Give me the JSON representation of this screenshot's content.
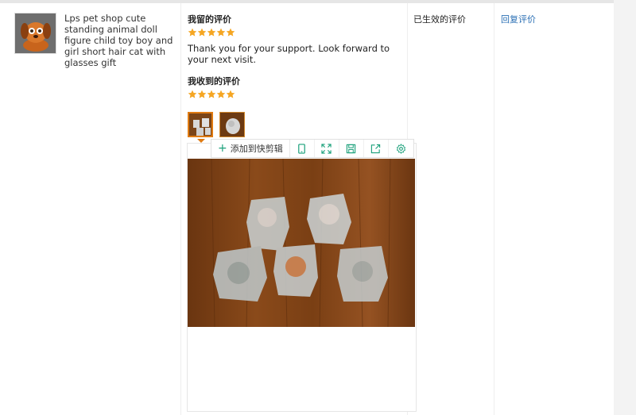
{
  "product": {
    "title": "Lps pet shop cute standing animal doll figure child toy boy and girl short hair cat with glasses gift",
    "thumbnail_icon": "product-photo"
  },
  "review": {
    "my_review_label": "我留的评价",
    "my_rating": 5,
    "my_text": "Thank you for your support. Look forward to your next visit.",
    "received_review_label": "我收到的评价",
    "received_rating": 5,
    "star_color": "#f5a623"
  },
  "attachments": {
    "count": 2,
    "active_index": 0
  },
  "image_toolbar": {
    "add_to_clip_label": "添加到快剪辑",
    "icons": [
      "phone-icon",
      "expand-icon",
      "save-icon",
      "share-icon",
      "settings-icon"
    ],
    "accent": "#1aa07a"
  },
  "status": {
    "text": "已生效的评价"
  },
  "action": {
    "reply_label": "回复评价",
    "link_color": "#2a6fb4"
  }
}
